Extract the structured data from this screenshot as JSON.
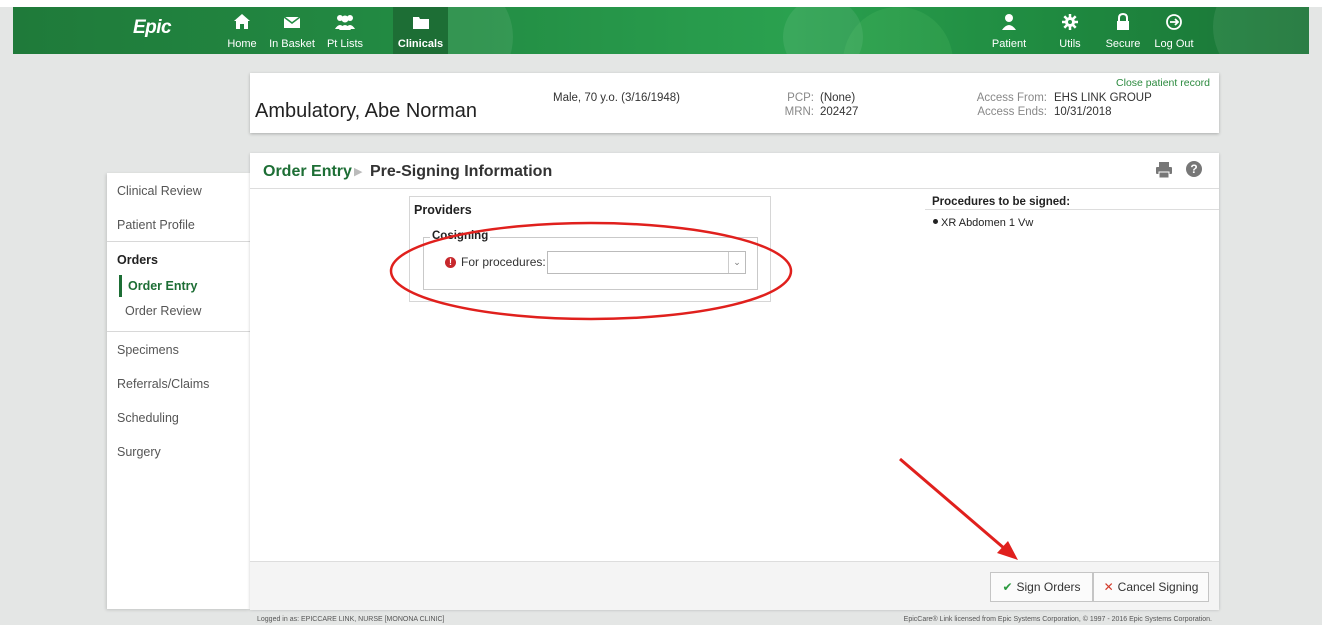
{
  "app": {
    "logo": "Epic",
    "nav_left": [
      {
        "label": "Home",
        "icon": "home-icon"
      },
      {
        "label": "In Basket",
        "icon": "envelope-icon"
      },
      {
        "label": "Pt Lists",
        "icon": "people-icon"
      },
      {
        "label": "Clinicals",
        "icon": "folder-icon",
        "active": true
      }
    ],
    "nav_right": [
      {
        "label": "Patient",
        "icon": "person-icon"
      },
      {
        "label": "Utils",
        "icon": "gear-icon"
      },
      {
        "label": "Secure",
        "icon": "lock-icon"
      },
      {
        "label": "Log Out",
        "icon": "logout-icon"
      }
    ]
  },
  "patient": {
    "name": "Ambulatory, Abe Norman",
    "demographics": "Male, 70 y.o. (3/16/1948)",
    "pcp_label": "PCP:",
    "pcp_value": "(None)",
    "mrn_label": "MRN:",
    "mrn_value": "202427",
    "access_from_label": "Access From:",
    "access_from_value": "EHS LINK GROUP",
    "access_ends_label": "Access Ends:",
    "access_ends_value": "10/31/2018",
    "close_link": "Close patient record"
  },
  "leftnav": {
    "clinical_review": "Clinical Review",
    "patient_profile": "Patient Profile",
    "orders": "Orders",
    "order_entry": "Order Entry",
    "order_review": "Order Review",
    "specimens": "Specimens",
    "referrals": "Referrals/Claims",
    "scheduling": "Scheduling",
    "surgery": "Surgery"
  },
  "page": {
    "breadcrumb_1": "Order Entry",
    "breadcrumb_2": "Pre-Signing Information",
    "providers_title": "Providers",
    "cosigning_legend": "Cosigning",
    "for_procedures_label": "For procedures:",
    "for_procedures_value": "",
    "procedures_title": "Procedures to be signed:",
    "procedures": [
      "XR Abdomen 1 Vw"
    ],
    "sign_button": "Sign Orders",
    "cancel_button": "Cancel Signing"
  },
  "footer": {
    "logged_in": "Logged in as: EPICCARE LINK, NURSE [MONONA CLINIC]",
    "license": "EpicCare® Link licensed from Epic Systems Corporation, © 1997 - 2016 Epic Systems Corporation."
  },
  "colors": {
    "header_green": "#238d44",
    "accent_green": "#1d6e35",
    "annotation_red": "#e0201d",
    "required_red": "#c7282c"
  }
}
